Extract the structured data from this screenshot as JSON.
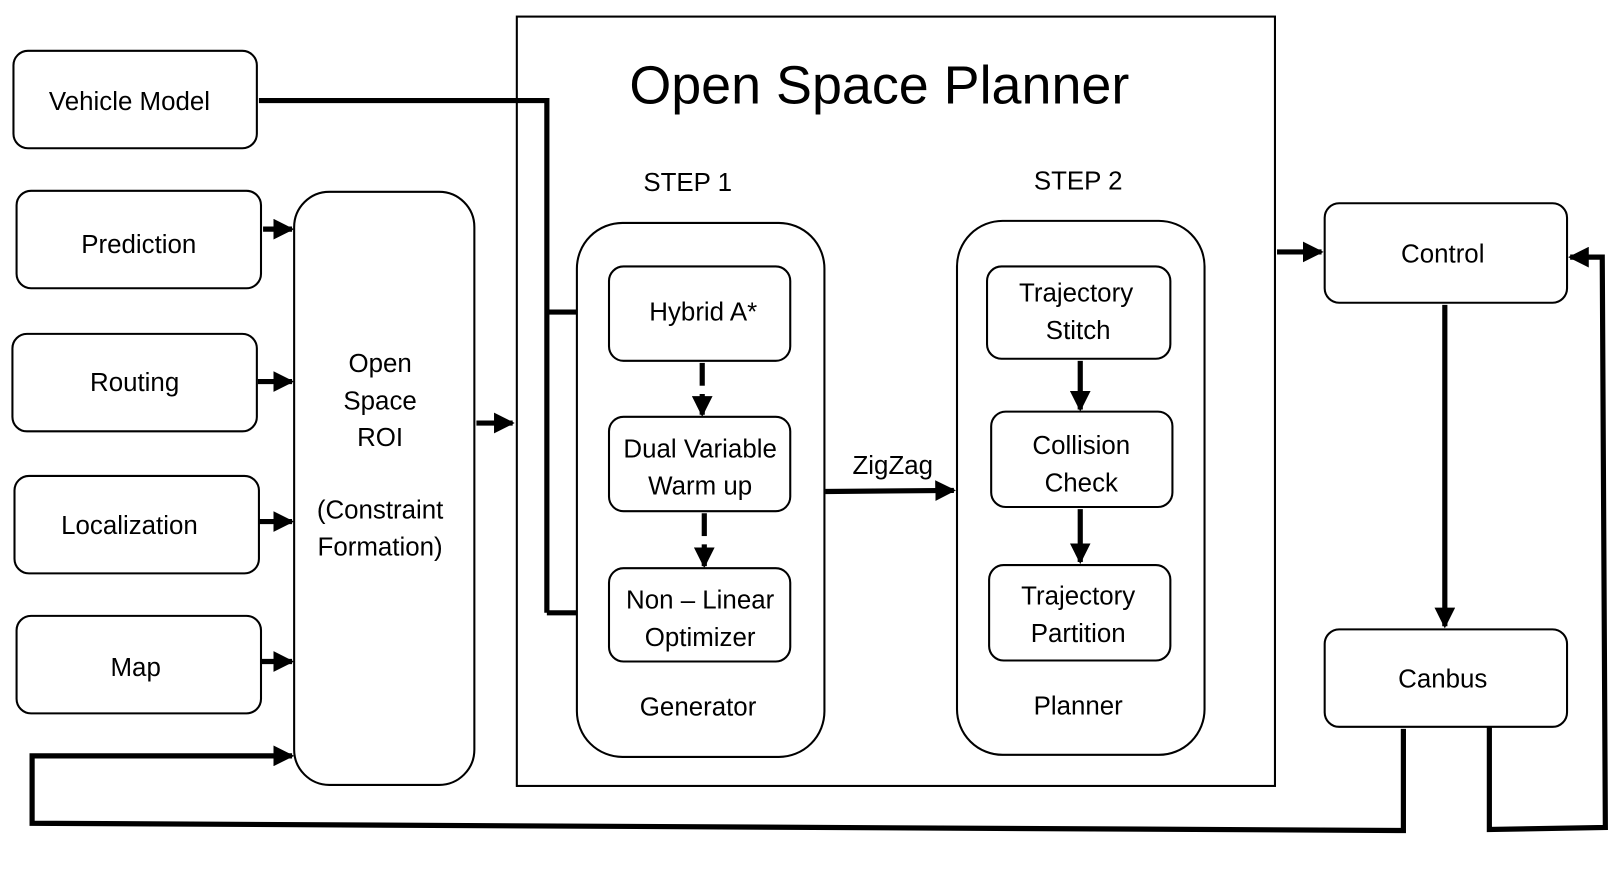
{
  "diagram": {
    "title": "Open Space Planner",
    "inputs": {
      "vehicle_model": "Vehicle Model",
      "prediction": "Prediction",
      "routing": "Routing",
      "localization": "Localization",
      "map": "Map"
    },
    "roi": {
      "lines": [
        "Open",
        "Space",
        "ROI",
        "",
        "(Constraint",
        "Formation)"
      ]
    },
    "step1": {
      "label": "STEP 1",
      "group": "Generator",
      "hybrid_a_star": "Hybrid A*",
      "dual_variable": [
        "Dual Variable",
        "Warm up"
      ],
      "nonlinear": [
        "Non – Linear",
        "Optimizer"
      ]
    },
    "step2": {
      "label": "STEP 2",
      "group": "Planner",
      "stitch": [
        "Trajectory",
        "Stitch"
      ],
      "collision": [
        "Collision",
        "Check"
      ],
      "partition": [
        "Trajectory",
        "Partition"
      ]
    },
    "edge_label_zigzag": "ZigZag",
    "outputs": {
      "control": "Control",
      "canbus": "Canbus"
    }
  }
}
